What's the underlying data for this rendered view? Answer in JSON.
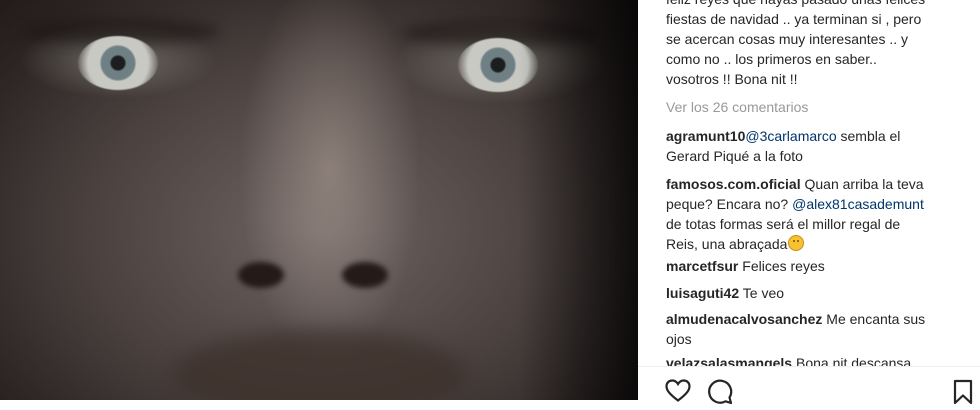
{
  "post": {
    "caption": "feliz reyes que hayas pasado unas felices\nfiestas de navidad .. ya terminan si , pero\nse acercan cosas muy interesantes .. y\ncomo no .. los primeros en saber..\nvosotros !! Bona nit !!",
    "view_all_comments": "Ver los 26 comentarios"
  },
  "comments": [
    {
      "user": "agramunt10",
      "lines": [
        [
          {
            "t": "mention",
            "v": "@3carlamarco"
          },
          {
            "t": "text",
            "v": " sembla el"
          }
        ],
        [
          {
            "t": "text",
            "v": "Gerard Piqué a la foto"
          }
        ]
      ]
    },
    {
      "user": "famosos.com.oficial",
      "lines": [
        [
          {
            "t": "text",
            "v": " Quan arriba la teva"
          }
        ],
        [
          {
            "t": "text",
            "v": "peque? Encara no? "
          },
          {
            "t": "mention",
            "v": "@alex81casademunt"
          }
        ],
        [
          {
            "t": "text",
            "v": "de totas formas será el millor regal de"
          }
        ],
        [
          {
            "t": "text",
            "v": "Reis, una abraçada"
          },
          {
            "t": "emoji",
            "v": "smiling-face"
          }
        ]
      ]
    },
    {
      "user": "marcetfsur",
      "lines": [
        [
          {
            "t": "text",
            "v": " Felices reyes"
          }
        ]
      ]
    },
    {
      "user": "luisaguti42",
      "lines": [
        [
          {
            "t": "text",
            "v": " Te veo"
          }
        ]
      ]
    },
    {
      "user": "almudenacalvosanchez",
      "lines": [
        [
          {
            "t": "text",
            "v": " Me encanta sus"
          }
        ],
        [
          {
            "t": "text",
            "v": "ojos"
          }
        ]
      ]
    },
    {
      "user": "velazsalasmangels",
      "lines": [
        [
          {
            "t": "text",
            "v": " Bona nit descansa"
          }
        ]
      ]
    }
  ],
  "actions": {
    "icons": [
      "heart-icon",
      "comment-icon",
      "bookmark-icon"
    ]
  },
  "colors": {
    "text": "#262626",
    "mention": "#003569",
    "muted": "#999999",
    "divider": "#efefef"
  }
}
